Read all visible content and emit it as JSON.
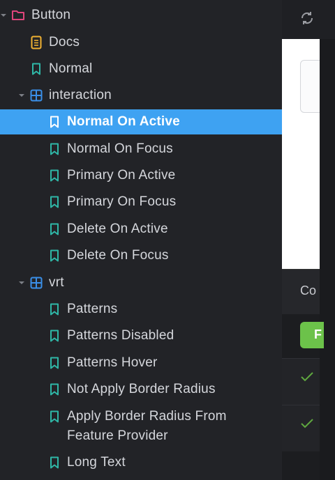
{
  "sidebar": {
    "group": {
      "label": "Button",
      "icon": "folder-icon"
    },
    "docs": {
      "label": "Docs",
      "icon": "document-icon"
    },
    "normal": {
      "label": "Normal",
      "icon": "bookmark-icon"
    },
    "interaction": {
      "label": "interaction",
      "icon": "grid-icon",
      "items": [
        {
          "label": "Normal On Active",
          "active": true
        },
        {
          "label": "Normal On Focus"
        },
        {
          "label": "Primary On Active"
        },
        {
          "label": "Primary On Focus"
        },
        {
          "label": "Delete On Active"
        },
        {
          "label": "Delete On Focus"
        }
      ]
    },
    "vrt": {
      "label": "vrt",
      "icon": "grid-icon",
      "items": [
        {
          "label": "Patterns"
        },
        {
          "label": "Patterns Disabled"
        },
        {
          "label": "Patterns Hover"
        },
        {
          "label": "Not Apply Border Radius"
        },
        {
          "label": "Apply Border Radius From Feature Provider"
        },
        {
          "label": "Long Text"
        }
      ]
    }
  },
  "right_panel": {
    "tab_label": "Co",
    "button_label": "F"
  },
  "colors": {
    "active": "#3ea2f2",
    "bookmark": "#2fb7a7",
    "folder": "#e0457b",
    "docs": "#f0b132",
    "component": "#3a8fe8",
    "green": "#6cc24a"
  }
}
